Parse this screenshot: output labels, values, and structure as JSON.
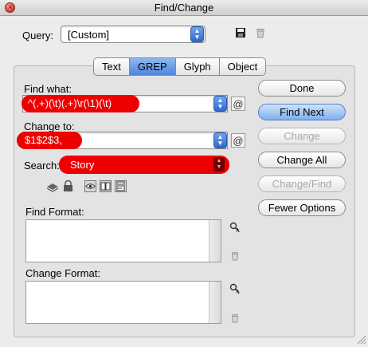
{
  "window": {
    "title": "Find/Change",
    "close_glyph": "×"
  },
  "query": {
    "label": "Query:",
    "value": "[Custom]",
    "save_icon": "save-query-icon",
    "delete_icon": "delete-query-icon"
  },
  "tabs": [
    {
      "label": "Text",
      "active": false
    },
    {
      "label": "GREP",
      "active": true
    },
    {
      "label": "Glyph",
      "active": false
    },
    {
      "label": "Object",
      "active": false
    }
  ],
  "find_what": {
    "label": "Find what:",
    "value": "^(.+)(\\t)(.+)\\r(\\1)(\\t)"
  },
  "change_to": {
    "label": "Change to:",
    "value": "$1$2$3,"
  },
  "search": {
    "label": "Search:",
    "value": "Story"
  },
  "special_char_glyph": "@",
  "find_format": {
    "label": "Find Format:"
  },
  "change_format": {
    "label": "Change Format:"
  },
  "buttons": {
    "done": "Done",
    "find_next": "Find Next",
    "change": "Change",
    "change_all": "Change All",
    "change_find": "Change/Find",
    "fewer_options": "Fewer Options"
  },
  "colors": {
    "accent": "#4f86da",
    "redaction": "#ee0000"
  }
}
